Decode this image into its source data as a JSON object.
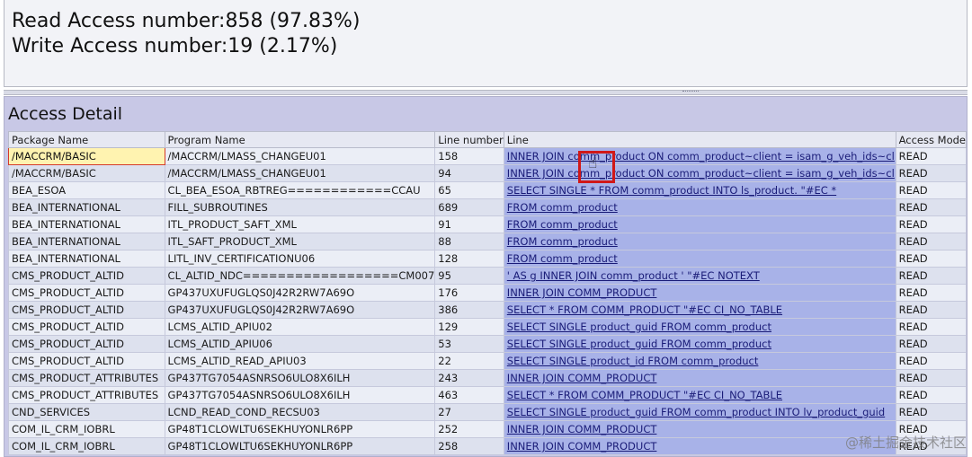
{
  "summary": {
    "read_line": "Read Access number:858 (97.83%)",
    "write_line": "Write Access number:19 (2.17%)"
  },
  "detail": {
    "title": "Access Detail",
    "columns": [
      "Package Name",
      "Program Name",
      "Line number",
      "Line",
      "Access Mode"
    ],
    "rows": [
      {
        "package": "/MACCRM/BASIC",
        "program": "/MACCRM/LMASS_CHANGEU01",
        "line_number": "158",
        "line": "INNER JOIN comm_product ON comm_product~client = isam_g_veh_ids~cl",
        "mode": "READ"
      },
      {
        "package": "/MACCRM/BASIC",
        "program": "/MACCRM/LMASS_CHANGEU01",
        "line_number": "94",
        "line": "INNER JOIN comm_product ON comm_product~client = isam_g_veh_ids~cl",
        "mode": "READ"
      },
      {
        "package": "BEA_ESOA",
        "program": "CL_BEA_ESOA_RBTREG============CCAU",
        "line_number": "65",
        "line": "SELECT SINGLE * FROM comm_product INTO ls_product. \"#EC *",
        "mode": "READ"
      },
      {
        "package": "BEA_INTERNATIONAL",
        "program": "FILL_SUBROUTINES",
        "line_number": "689",
        "line": "FROM comm_product",
        "mode": "READ"
      },
      {
        "package": "BEA_INTERNATIONAL",
        "program": "ITL_PRODUCT_SAFT_XML",
        "line_number": "91",
        "line": "FROM comm_product",
        "mode": "READ"
      },
      {
        "package": "BEA_INTERNATIONAL",
        "program": "ITL_SAFT_PRODUCT_XML",
        "line_number": "88",
        "line": "FROM comm_product",
        "mode": "READ"
      },
      {
        "package": "BEA_INTERNATIONAL",
        "program": "LITL_INV_CERTIFICATIONU06",
        "line_number": "128",
        "line": "FROM comm_product",
        "mode": "READ"
      },
      {
        "package": "CMS_PRODUCT_ALTID",
        "program": "CL_ALTID_NDC==================CM007",
        "line_number": "95",
        "line": "' AS g INNER JOIN comm_product ' \"#EC NOTEXT",
        "mode": "READ"
      },
      {
        "package": "CMS_PRODUCT_ALTID",
        "program": "GP437UXUFUGLQS0J42R2RW7A69O",
        "line_number": "176",
        "line": "INNER JOIN COMM_PRODUCT",
        "mode": "READ"
      },
      {
        "package": "CMS_PRODUCT_ALTID",
        "program": "GP437UXUFUGLQS0J42R2RW7A69O",
        "line_number": "386",
        "line": "SELECT * FROM COMM_PRODUCT \"#EC CI_NO_TABLE",
        "mode": "READ"
      },
      {
        "package": "CMS_PRODUCT_ALTID",
        "program": "LCMS_ALTID_APIU02",
        "line_number": "129",
        "line": "SELECT SINGLE product_guid FROM comm_product",
        "mode": "READ"
      },
      {
        "package": "CMS_PRODUCT_ALTID",
        "program": "LCMS_ALTID_APIU06",
        "line_number": "53",
        "line": "SELECT SINGLE product_guid FROM comm_product",
        "mode": "READ"
      },
      {
        "package": "CMS_PRODUCT_ALTID",
        "program": "LCMS_ALTID_READ_APIU03",
        "line_number": "22",
        "line": "SELECT SINGLE product_id FROM comm_product",
        "mode": "READ"
      },
      {
        "package": "CMS_PRODUCT_ATTRIBUTES",
        "program": "GP437TG7054ASNRSO6ULO8X6ILH",
        "line_number": "243",
        "line": "INNER JOIN COMM_PRODUCT",
        "mode": "READ"
      },
      {
        "package": "CMS_PRODUCT_ATTRIBUTES",
        "program": "GP437TG7054ASNRSO6ULO8X6ILH",
        "line_number": "463",
        "line": "SELECT * FROM COMM_PRODUCT \"#EC CI_NO_TABLE",
        "mode": "READ"
      },
      {
        "package": "CND_SERVICES",
        "program": "LCND_READ_COND_RECSU03",
        "line_number": "27",
        "line": "SELECT SINGLE product_guid FROM comm_product INTO lv_product_guid",
        "mode": "READ"
      },
      {
        "package": "COM_IL_CRM_IOBRL",
        "program": "GP48T1CLOWLTU6SEKHUYONLR6PP",
        "line_number": "252",
        "line": "INNER JOIN COMM_PRODUCT",
        "mode": "READ"
      },
      {
        "package": "COM_IL_CRM_IOBRL",
        "program": "GP48T1CLOWLTU6SEKHUYONLR6PP",
        "line_number": "258",
        "line": "INNER JOIN COMM_PRODUCT",
        "mode": "READ"
      }
    ]
  },
  "cursor": {
    "icon": "hand-pointer-icon",
    "glyph": "☝"
  },
  "watermark": "@稀土掘金技术社区",
  "colors": {
    "line_link": "#1a1c78",
    "line_bg": "#a8b2e8",
    "selected_bg": "#fff3b0",
    "highlight_box": "#d01818"
  }
}
